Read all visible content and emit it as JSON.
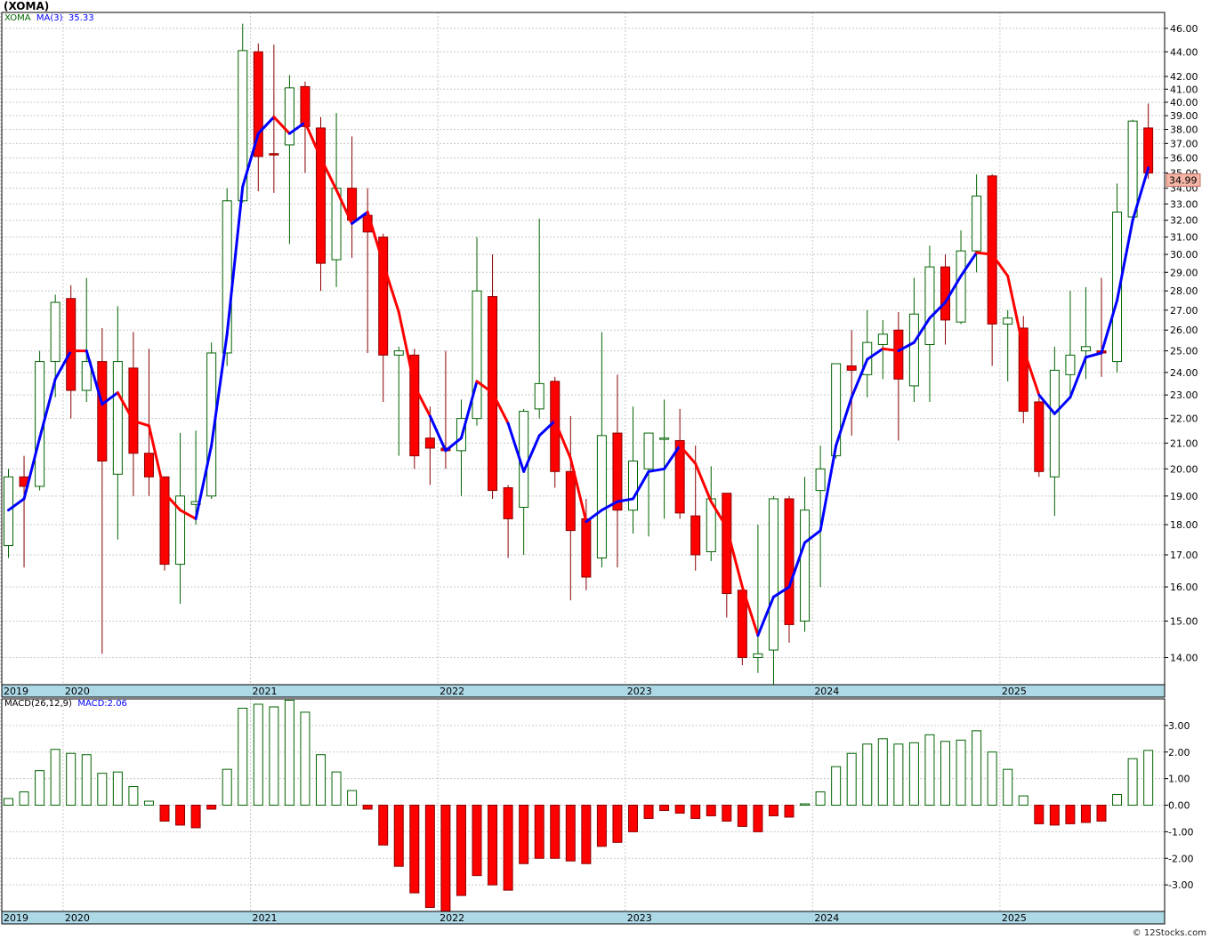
{
  "title": "(XOMA)",
  "credit": "© 12Stocks.com",
  "price_legend": {
    "ticker": "XOMA",
    "ma_label": "MA(3)",
    "ma_value": "35.33"
  },
  "macd_legend": {
    "label": "MACD(26,12,9)",
    "value_label": "MACD:2.06"
  },
  "last_price_tag": "34.99",
  "colors": {
    "up": "#006400",
    "down": "#ff0000",
    "ma_up": "#0000ff",
    "ma_down": "#ff0000",
    "grid": "#c8c8c8",
    "axis_band": "#add8e6",
    "tag_bg": "#f4b5a6"
  },
  "chart_data": [
    {
      "type": "candlestick",
      "interval": "monthly",
      "y_scale": "log",
      "ylim": [
        13.3,
        47.4
      ],
      "y_ticks": [
        14,
        15,
        16,
        17,
        18,
        19,
        20,
        21,
        22,
        23,
        24,
        25,
        26,
        27,
        28,
        29,
        30,
        31,
        32,
        33,
        34,
        35,
        36,
        37,
        38,
        39,
        40,
        41,
        42,
        44,
        46
      ],
      "x_labels": [
        "2019",
        "2020",
        "2021",
        "2022",
        "2023",
        "2024",
        "2025"
      ],
      "x_label_index": [
        0,
        4,
        16,
        28,
        40,
        52,
        64
      ],
      "ohlc": [
        [
          17.3,
          20.0,
          16.9,
          19.7
        ],
        [
          19.7,
          20.5,
          16.6,
          19.35
        ],
        [
          19.35,
          25.0,
          19.2,
          24.5
        ],
        [
          24.5,
          27.8,
          22.9,
          27.4
        ],
        [
          27.6,
          28.3,
          22.0,
          23.2
        ],
        [
          23.2,
          28.7,
          22.7,
          24.5
        ],
        [
          24.5,
          26.1,
          14.1,
          20.3
        ],
        [
          19.8,
          27.2,
          17.5,
          24.5
        ],
        [
          24.2,
          25.9,
          19.0,
          20.6
        ],
        [
          20.6,
          25.1,
          19.0,
          19.7
        ],
        [
          19.7,
          17.5,
          16.5,
          16.7
        ],
        [
          16.7,
          21.4,
          15.5,
          19.0
        ],
        [
          18.7,
          21.5,
          18.0,
          18.8
        ],
        [
          19.0,
          25.4,
          18.9,
          24.9
        ],
        [
          24.9,
          34.0,
          24.3,
          33.2
        ],
        [
          33.2,
          46.4,
          33.1,
          44.1
        ],
        [
          44.0,
          44.7,
          33.8,
          36.1
        ],
        [
          36.3,
          44.6,
          33.7,
          36.2
        ],
        [
          36.9,
          42.1,
          30.6,
          41.1
        ],
        [
          41.2,
          41.6,
          35.0,
          38.2
        ],
        [
          38.1,
          38.9,
          28.0,
          29.5
        ],
        [
          29.7,
          39.2,
          28.2,
          34.0
        ],
        [
          34.0,
          37.5,
          29.8,
          32.0
        ],
        [
          32.3,
          34.0,
          24.9,
          31.3
        ],
        [
          31.0,
          31.2,
          22.7,
          24.8
        ],
        [
          24.8,
          25.2,
          20.5,
          25.0
        ],
        [
          24.8,
          25.1,
          20.0,
          20.5
        ],
        [
          21.2,
          22.5,
          19.4,
          20.8
        ],
        [
          20.8,
          25.0,
          20.0,
          20.7
        ],
        [
          20.7,
          22.8,
          19.0,
          22.0
        ],
        [
          22.0,
          31.0,
          21.7,
          28.0
        ],
        [
          27.7,
          30.0,
          18.9,
          19.2
        ],
        [
          19.3,
          19.4,
          16.9,
          18.2
        ],
        [
          18.6,
          22.4,
          17.0,
          22.3
        ],
        [
          22.4,
          32.1,
          22.0,
          23.5
        ],
        [
          23.6,
          23.8,
          19.3,
          19.9
        ],
        [
          19.9,
          22.1,
          15.6,
          17.8
        ],
        [
          18.2,
          18.9,
          15.9,
          16.3
        ],
        [
          16.9,
          25.9,
          16.6,
          21.3
        ],
        [
          21.4,
          23.9,
          16.6,
          18.5
        ],
        [
          18.5,
          22.5,
          17.7,
          20.3
        ],
        [
          20.0,
          21.4,
          17.6,
          21.4
        ],
        [
          21.2,
          22.8,
          18.2,
          21.2
        ],
        [
          21.1,
          22.4,
          18.2,
          18.4
        ],
        [
          18.3,
          20.9,
          16.5,
          17.0
        ],
        [
          17.1,
          20.1,
          16.8,
          18.9
        ],
        [
          19.1,
          19.1,
          15.1,
          15.8
        ],
        [
          15.9,
          16.0,
          13.8,
          14.0
        ],
        [
          14.0,
          18.0,
          13.6,
          14.1
        ],
        [
          14.2,
          19.0,
          13.3,
          18.9
        ],
        [
          18.9,
          19.0,
          14.4,
          14.9
        ],
        [
          15.0,
          19.7,
          14.7,
          18.5
        ],
        [
          19.2,
          20.9,
          16.0,
          20.0
        ],
        [
          20.5,
          24.2,
          20.4,
          24.4
        ],
        [
          24.3,
          26.0,
          21.3,
          24.1
        ],
        [
          23.9,
          27.0,
          22.9,
          25.4
        ],
        [
          25.3,
          26.5,
          23.7,
          25.8
        ],
        [
          26.0,
          26.9,
          21.1,
          23.7
        ],
        [
          23.4,
          28.7,
          22.7,
          26.8
        ],
        [
          25.3,
          30.5,
          22.7,
          29.3
        ],
        [
          29.3,
          30.0,
          25.3,
          26.5
        ],
        [
          26.4,
          31.4,
          26.3,
          30.2
        ],
        [
          30.2,
          34.9,
          29.0,
          33.5
        ],
        [
          34.8,
          34.9,
          24.3,
          26.3
        ],
        [
          26.3,
          27.0,
          23.6,
          26.6
        ],
        [
          26.1,
          26.7,
          21.8,
          22.3
        ],
        [
          22.7,
          22.9,
          19.7,
          19.9
        ],
        [
          19.7,
          25.2,
          18.3,
          24.1
        ],
        [
          23.9,
          28.0,
          23.0,
          24.8
        ],
        [
          25.0,
          28.2,
          23.7,
          25.2
        ],
        [
          25.0,
          28.7,
          23.8,
          24.9
        ],
        [
          24.5,
          34.3,
          24.0,
          32.5
        ],
        [
          32.2,
          38.7,
          32.1,
          38.6
        ],
        [
          38.1,
          39.9,
          34.6,
          34.99
        ]
      ],
      "ma": [
        18.5,
        18.9,
        21.2,
        23.7,
        25.0,
        25.0,
        22.6,
        23.1,
        21.9,
        21.7,
        19.1,
        18.5,
        18.2,
        20.9,
        25.8,
        34.1,
        37.7,
        38.9,
        37.7,
        38.5,
        36.0,
        33.9,
        31.8,
        32.5,
        29.5,
        26.9,
        23.4,
        22.1,
        20.7,
        21.2,
        23.6,
        23.1,
        21.8,
        19.9,
        21.3,
        21.9,
        20.4,
        18.1,
        18.5,
        18.8,
        18.9,
        19.9,
        20.0,
        20.9,
        20.2,
        18.8,
        17.9,
        16.0,
        14.6,
        15.7,
        16.0,
        17.4,
        17.8,
        20.9,
        22.9,
        24.6,
        25.1,
        25.0,
        25.4,
        26.6,
        27.4,
        28.8,
        30.1,
        30.0,
        28.8,
        25.1,
        23.0,
        22.2,
        22.9,
        24.7,
        24.9,
        27.5,
        32.0,
        35.33
      ],
      "ma_up": [
        true,
        true,
        true,
        true,
        true,
        false,
        true,
        true,
        false,
        false,
        false,
        false,
        false,
        true,
        true,
        true,
        true,
        true,
        false,
        true,
        false,
        false,
        false,
        true,
        false,
        false,
        false,
        false,
        true,
        true,
        true,
        false,
        false,
        true,
        true,
        true,
        false,
        false,
        true,
        true,
        true,
        true,
        true,
        true,
        false,
        false,
        false,
        false,
        false,
        true,
        true,
        true,
        true,
        true,
        true,
        true,
        true,
        false,
        true,
        true,
        true,
        true,
        true,
        false,
        false,
        false,
        false,
        true,
        true,
        true,
        true,
        true,
        true,
        true
      ]
    },
    {
      "type": "bar",
      "name": "MACD(26,12,9)",
      "ylim": [
        -4.0,
        4.0
      ],
      "y_ticks": [
        3.0,
        2.0,
        1.0,
        0.0,
        -1.0,
        -2.0,
        -3.0
      ],
      "y_tick_labels": [
        "3.00",
        "2.00",
        "1.00",
        "0.00",
        "-1.00",
        "-2.00",
        "-3.00"
      ],
      "x_labels": [
        "2019",
        "2020",
        "2021",
        "2022",
        "2023",
        "2024",
        "2025"
      ],
      "values": [
        0.25,
        0.5,
        1.3,
        2.1,
        1.95,
        1.9,
        1.2,
        1.25,
        0.7,
        0.15,
        -0.6,
        -0.75,
        -0.85,
        -0.15,
        1.35,
        3.65,
        3.8,
        3.7,
        3.95,
        3.5,
        1.9,
        1.25,
        0.55,
        -0.15,
        -1.5,
        -2.3,
        -3.3,
        -3.85,
        -4.0,
        -3.4,
        -2.65,
        -3.0,
        -3.2,
        -2.2,
        -2.0,
        -2.0,
        -2.1,
        -2.2,
        -1.55,
        -1.4,
        -1.0,
        -0.5,
        -0.2,
        -0.3,
        -0.5,
        -0.4,
        -0.6,
        -0.8,
        -1.0,
        -0.4,
        -0.45,
        0.05,
        0.5,
        1.45,
        1.95,
        2.3,
        2.5,
        2.3,
        2.35,
        2.65,
        2.4,
        2.45,
        2.8,
        2.0,
        1.35,
        0.35,
        -0.7,
        -0.75,
        -0.7,
        -0.65,
        -0.6,
        0.4,
        1.75,
        2.06
      ]
    }
  ]
}
